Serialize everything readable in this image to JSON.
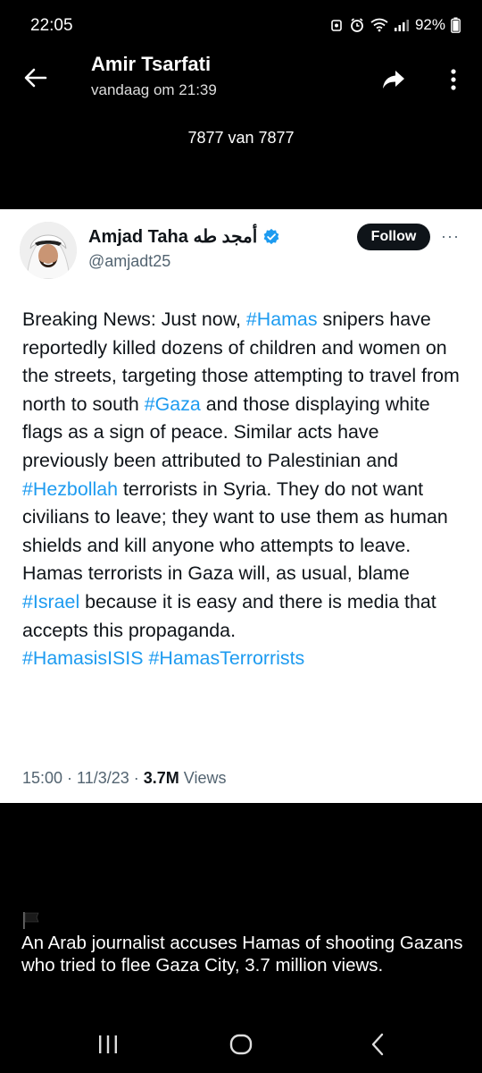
{
  "status_bar": {
    "time": "22:05",
    "battery": "92%",
    "icons": [
      "alarm-icon",
      "clock-icon",
      "wifi-icon",
      "signal-icon",
      "battery-icon"
    ]
  },
  "header": {
    "sender_name": "Amir Tsarfati",
    "date": "vandaag om 21:39",
    "counter": "7877 van 7877"
  },
  "tweet": {
    "author_name": "Amjad Taha أمجد طه",
    "handle": "@amjadt25",
    "follow_label": "Follow",
    "more": "···",
    "text_segments": [
      {
        "t": "Breaking News: Just now, ",
        "h": false
      },
      {
        "t": "#Hamas",
        "h": true
      },
      {
        "t": " snipers have reportedly killed dozens of children and women on the streets, targeting those attempting to travel from north to south ",
        "h": false
      },
      {
        "t": "#Gaza",
        "h": true
      },
      {
        "t": " and those displaying white flags as a sign of peace. Similar acts have previously been attributed to Palestinian and ",
        "h": false
      },
      {
        "t": "#Hezbollah",
        "h": true
      },
      {
        "t": " terrorists in Syria. They do not want civilians to leave; they want to use them as human shields and kill anyone who attempts to leave. Hamas terrorists in Gaza will, as usual, blame ",
        "h": false
      },
      {
        "t": "#Israel",
        "h": true
      },
      {
        "t": " because it is easy and there is media that accepts this propaganda.",
        "h": false
      },
      {
        "t": "\n",
        "h": false
      },
      {
        "t": "#HamasisISIS",
        "h": true
      },
      {
        "t": " ",
        "h": false
      },
      {
        "t": "#HamasTerrorrists",
        "h": true
      }
    ],
    "meta_time": "15:00 · 11/3/23 · ",
    "views_count": "3.7M",
    "views_label": " Views"
  },
  "caption": {
    "text": "An Arab journalist accuses Hamas of shooting Gazans who tried to flee Gaza City, 3.7 million views."
  },
  "colors": {
    "background": "#000000",
    "card": "#ffffff",
    "hashtag": "#1d9bf0",
    "verified": "#1d9bf0",
    "text_dark": "#0f1419",
    "text_muted": "#536471"
  }
}
